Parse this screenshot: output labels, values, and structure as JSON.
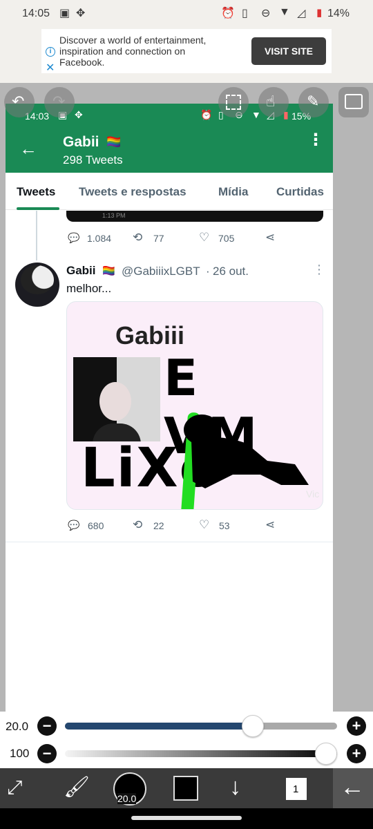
{
  "status_bar": {
    "time": "14:05",
    "battery": "14%"
  },
  "ad": {
    "text": "Discover a world of entertainment, inspiration and connection on Facebook.",
    "button": "VISIT SITE"
  },
  "inner_status": {
    "time": "14:03",
    "battery": "15%"
  },
  "profile": {
    "name": "Gabii",
    "flag": "🏳️‍🌈",
    "tweet_count": "298 Tweets"
  },
  "tabs": [
    "Tweets",
    "Tweets e respostas",
    "Mídia",
    "Curtidas"
  ],
  "prev_tweet": {
    "time_label": "1:13 PM",
    "replies": "1.084",
    "retweets": "77",
    "likes": "705"
  },
  "tweet": {
    "author": "Gabii",
    "handle": "@GabiiixLGBT",
    "date": "26 out.",
    "text": "melhor...",
    "image_text": {
      "line1": "Gabiii",
      "line2": "E VM",
      "line3": "LiXo",
      "watermark": "Vic"
    },
    "replies": "680",
    "retweets": "22",
    "likes": "53"
  },
  "sliders": {
    "size_value": "20.0",
    "size_level": 0.69,
    "opacity_value": "100",
    "opacity_level": 1.0
  },
  "toolbar": {
    "brush_size": "20.0",
    "layer_count": "1"
  },
  "colors": {
    "twitter_green": "#1a8a55",
    "slider_blue": "#24476f"
  }
}
